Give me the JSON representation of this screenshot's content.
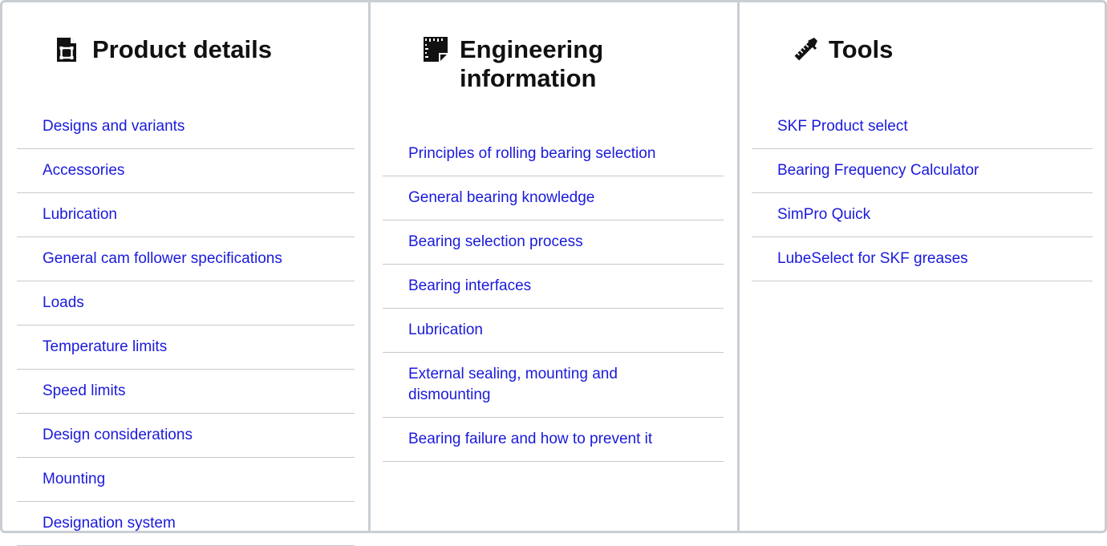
{
  "columns": [
    {
      "heading": "Product details",
      "icon": "product-sheet-icon",
      "links": [
        "Designs and variants",
        "Accessories",
        "Lubrication",
        "General cam follower specifications",
        "Loads",
        "Temperature limits",
        "Speed limits",
        "Design considerations",
        "Mounting",
        "Designation system"
      ]
    },
    {
      "heading": "Engineering information",
      "icon": "engineering-drawing-icon",
      "links": [
        "Principles of rolling bearing selection",
        "General bearing knowledge",
        "Bearing selection process",
        "Bearing interfaces",
        "Lubrication",
        "External sealing, mounting and dismounting",
        "Bearing failure and how to prevent it"
      ]
    },
    {
      "heading": "Tools",
      "icon": "ruler-pencil-icon",
      "links": [
        "SKF Product select",
        "Bearing Frequency Calculator",
        "SimPro Quick",
        "LubeSelect for SKF greases"
      ]
    }
  ],
  "colors": {
    "link": "#1a1adb",
    "border": "#c9ced3",
    "heading": "#111111"
  }
}
